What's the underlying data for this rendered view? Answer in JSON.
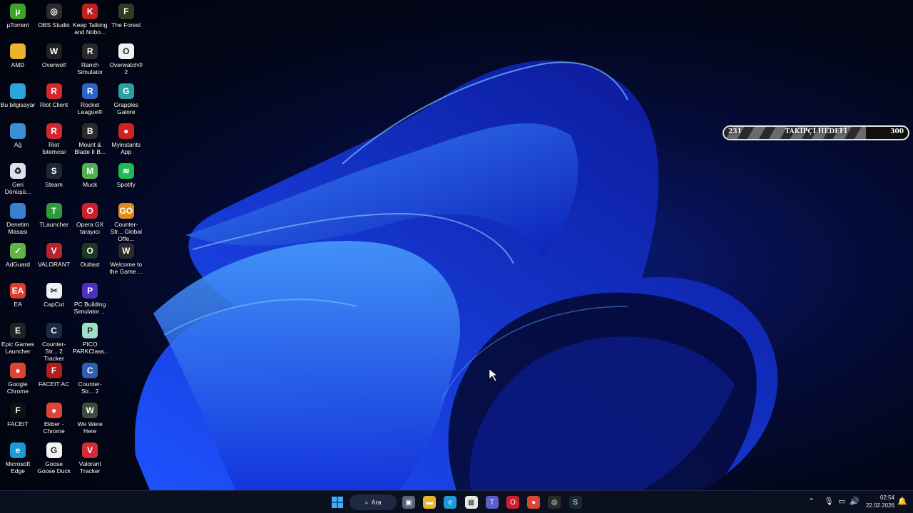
{
  "desktop_icons": [
    {
      "label": "µTorrent",
      "icon": "utorrent-icon",
      "color": "#3fa32b",
      "glyph": "µ"
    },
    {
      "label": "AMD",
      "icon": "folder-icon",
      "color": "#e9b42a",
      "glyph": ""
    },
    {
      "label": "Bu bilgisayar",
      "icon": "computer-icon",
      "color": "#28a6d9",
      "glyph": ""
    },
    {
      "label": "Ağ",
      "icon": "network-icon",
      "color": "#3c8fd2",
      "glyph": ""
    },
    {
      "label": "Geri Dönüşü...",
      "icon": "recycle-bin-icon",
      "color": "#d9e3ec",
      "glyph": "♻"
    },
    {
      "label": "Denetim Masası",
      "icon": "control-panel-icon",
      "color": "#3a7fd0",
      "glyph": ""
    },
    {
      "label": "AdGuard",
      "icon": "adguard-icon",
      "color": "#5eb446",
      "glyph": "✓"
    },
    {
      "label": "EA",
      "icon": "ea-icon",
      "color": "#e23b2e",
      "glyph": "EA"
    },
    {
      "label": "Epic Games Launcher",
      "icon": "epic-games-icon",
      "color": "#222222",
      "glyph": "E"
    },
    {
      "label": "Google Chrome",
      "icon": "chrome-icon",
      "color": "#db4437",
      "glyph": "●"
    },
    {
      "label": "FACEIT",
      "icon": "faceit-icon",
      "color": "#111111",
      "glyph": "F"
    },
    {
      "label": "Microsoft Edge",
      "icon": "edge-icon",
      "color": "#1b9ad8",
      "glyph": "e"
    },
    {
      "label": "OBS Studio",
      "icon": "obs-icon",
      "color": "#2b2b2b",
      "glyph": "◎"
    },
    {
      "label": "Overwolf",
      "icon": "overwolf-icon",
      "color": "#222222",
      "glyph": "W"
    },
    {
      "label": "Riot Client",
      "icon": "riot-client-icon",
      "color": "#d7272e",
      "glyph": "R"
    },
    {
      "label": "Riot İstemcisi",
      "icon": "riot-client-icon",
      "color": "#d7272e",
      "glyph": "R"
    },
    {
      "label": "Steam",
      "icon": "steam-icon",
      "color": "#1b2838",
      "glyph": "S"
    },
    {
      "label": "TLauncher",
      "icon": "tlauncher-icon",
      "color": "#2f9c3a",
      "glyph": "T"
    },
    {
      "label": "VALORANT",
      "icon": "valorant-icon",
      "color": "#b8242e",
      "glyph": "V"
    },
    {
      "label": "CapCut",
      "icon": "capcut-icon",
      "color": "#f0f0f0",
      "glyph": "✂"
    },
    {
      "label": "Counter-Str... 2 Tracker",
      "icon": "cs2-tracker-icon",
      "color": "#1d2a45",
      "glyph": "C"
    },
    {
      "label": "FACEIT AC",
      "icon": "faceit-ac-icon",
      "color": "#b51d1d",
      "glyph": "F"
    },
    {
      "label": "Ekber - Chrome",
      "icon": "chrome-profile-icon",
      "color": "#db4437",
      "glyph": "●"
    },
    {
      "label": "Goose Goose Duck",
      "icon": "goose-goose-duck-icon",
      "color": "#f2f2f2",
      "glyph": "G"
    },
    {
      "label": "Keep Talking and Nobo...",
      "icon": "keep-talking-icon",
      "color": "#c22020",
      "glyph": "K"
    },
    {
      "label": "Ranch Simulator",
      "icon": "ranch-simulator-icon",
      "color": "#2a2a2a",
      "glyph": "R"
    },
    {
      "label": "Rocket League®",
      "icon": "rocket-league-icon",
      "color": "#2b64c8",
      "glyph": "R"
    },
    {
      "label": "Mount & Blade II B...",
      "icon": "bannerlord-icon",
      "color": "#2b2b2b",
      "glyph": "B"
    },
    {
      "label": "Muck",
      "icon": "muck-icon",
      "color": "#4fb04d",
      "glyph": "M"
    },
    {
      "label": "Opera GX tarayıcı",
      "icon": "opera-gx-icon",
      "color": "#cf1f2e",
      "glyph": "O"
    },
    {
      "label": "Outlast",
      "icon": "outlast-icon",
      "color": "#1c3a22",
      "glyph": "O"
    },
    {
      "label": "PC Building Simulator ...",
      "icon": "pc-building-icon",
      "color": "#4f2fc2",
      "glyph": "P"
    },
    {
      "label": "PICO PARKClass...",
      "icon": "pico-park-icon",
      "color": "#9de0c8",
      "glyph": "P"
    },
    {
      "label": "Counter-Str... 2",
      "icon": "cs2-icon",
      "color": "#2f5fb0",
      "glyph": "C"
    },
    {
      "label": "We Were Here",
      "icon": "we-were-here-icon",
      "color": "#3e4d3a",
      "glyph": "W"
    },
    {
      "label": "Valorant Tracker",
      "icon": "valorant-tracker-icon",
      "color": "#d42c36",
      "glyph": "V"
    },
    {
      "label": "The Forest",
      "icon": "the-forest-icon",
      "color": "#2e3d20",
      "glyph": "F"
    },
    {
      "label": "Overwatch® 2",
      "icon": "overwatch-icon",
      "color": "#f2f2f2",
      "glyph": "O"
    },
    {
      "label": "Grapples Galore",
      "icon": "grapples-galore-icon",
      "color": "#2ba0a2",
      "glyph": "G"
    },
    {
      "label": "Myinstants App",
      "icon": "myinstants-icon",
      "color": "#d21f1f",
      "glyph": "●"
    },
    {
      "label": "Spotify",
      "icon": "spotify-icon",
      "color": "#1db954",
      "glyph": "≋"
    },
    {
      "label": "Counter-Str... Global Offe...",
      "icon": "csgo-icon",
      "color": "#e08a1c",
      "glyph": "GO"
    },
    {
      "label": "Welcome to the Game ...",
      "icon": "welcome-game-icon",
      "color": "#2a2a2a",
      "glyph": "W"
    }
  ],
  "follower_goal": {
    "current": "231",
    "label": "TAKİPÇİ HEDEFİ",
    "target": "300",
    "progress_fraction": 0.77
  },
  "taskbar": {
    "search_label": "Ara",
    "pinned": [
      {
        "name": "task-view-icon",
        "color": "#5b6478",
        "glyph": "▣"
      },
      {
        "name": "file-explorer-icon",
        "color": "#e9b42a",
        "glyph": "▬"
      },
      {
        "name": "edge-icon",
        "color": "#1b9ad8",
        "glyph": "e"
      },
      {
        "name": "store-icon",
        "color": "#e8e8e8",
        "glyph": "▦"
      },
      {
        "name": "teams-icon",
        "color": "#5b5fc7",
        "glyph": "T"
      },
      {
        "name": "opera-gx-icon",
        "color": "#cf1f2e",
        "glyph": "O"
      },
      {
        "name": "chrome-icon",
        "color": "#db4437",
        "glyph": "●"
      },
      {
        "name": "obs-icon",
        "color": "#2b2b2b",
        "glyph": "◎"
      },
      {
        "name": "steam-icon",
        "color": "#1b2838",
        "glyph": "S"
      }
    ],
    "time": "02:54",
    "date": "22.02.2026"
  }
}
